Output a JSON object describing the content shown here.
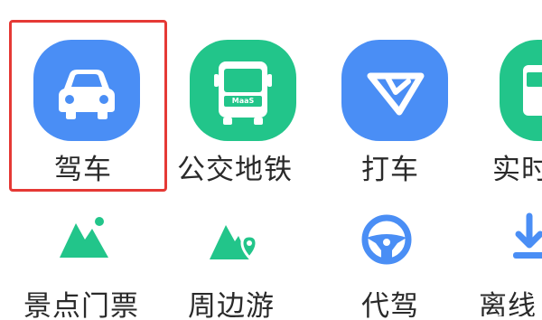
{
  "grid": {
    "row1": [
      {
        "id": "drive",
        "label": "驾车",
        "icon": "car-icon",
        "color": "#4a8ef5"
      },
      {
        "id": "bus",
        "label": "公交地铁",
        "icon": "bus-icon",
        "badge": "MaaS",
        "color": "#22c58a"
      },
      {
        "id": "taxi",
        "label": "打车",
        "icon": "taxi-logo-icon",
        "color": "#4a8ef5"
      },
      {
        "id": "realtime",
        "label": "实时",
        "icon": "realtime-bus-icon",
        "color": "#22c58a"
      }
    ],
    "row2": [
      {
        "id": "tickets",
        "label": "景点门票",
        "icon": "mountain-icon",
        "color": "#22c58a"
      },
      {
        "id": "around",
        "label": "周边游",
        "icon": "mountain-pin-icon",
        "color": "#22c58a"
      },
      {
        "id": "chauffeur",
        "label": "代驾",
        "icon": "steering-wheel-icon",
        "color": "#4a8ef5"
      },
      {
        "id": "offline",
        "label": "离线",
        "icon": "download-icon",
        "color": "#4a8ef5"
      }
    ]
  },
  "highlight": {
    "target": "drive",
    "color": "#e53935"
  }
}
